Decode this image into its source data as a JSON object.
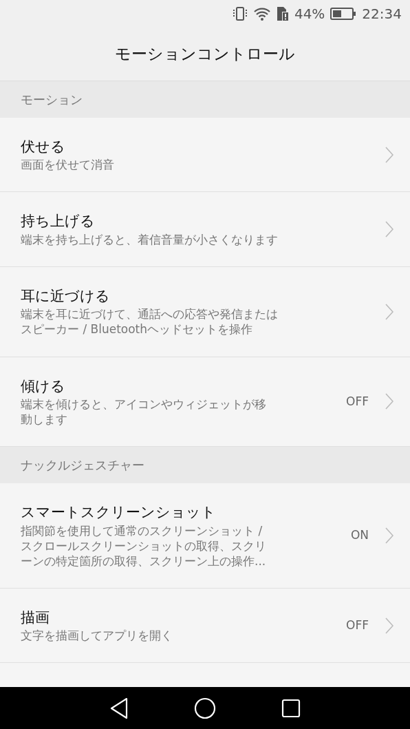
{
  "status_bar": {
    "battery": "44%",
    "time": "22:34"
  },
  "title": "モーションコントロール",
  "sections": [
    {
      "header": "モーション",
      "items": [
        {
          "title": "伏せる",
          "description": "画面を伏せて消音"
        },
        {
          "title": "持ち上げる",
          "description": "端末を持ち上げると、着信音量が小さくなります"
        },
        {
          "title": "耳に近づける",
          "description": "端末を耳に近づけて、通話への応答や発信またはスピーカー / Bluetoothヘッドセットを操作"
        },
        {
          "title": "傾ける",
          "description": "端末を傾けると、アイコンやウィジェットが移動します",
          "value": "OFF"
        }
      ]
    },
    {
      "header": "ナックルジェスチャー",
      "items": [
        {
          "title": "スマートスクリーンショット",
          "description": "指関節を使用して通常のスクリーンショット /スクロールスクリーンショットの取得、スクリーンの特定箇所の取得、スクリーン上の操作...",
          "value": "ON"
        },
        {
          "title": "描画",
          "description": "文字を描画してアプリを開く",
          "value": "OFF"
        }
      ]
    }
  ]
}
